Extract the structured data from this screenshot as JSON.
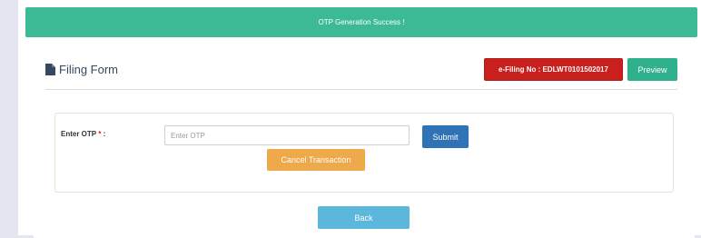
{
  "alert": {
    "message": "OTP Generation Success !"
  },
  "header": {
    "title": "Filing Form",
    "title_icon": "file-icon",
    "efiling_label": "e-Filing No : EDLWT0101502017",
    "preview_label": "Preview"
  },
  "otp_form": {
    "label": "Enter OTP",
    "required_mark": "*",
    "label_suffix": " :",
    "input_placeholder": "Enter OTP",
    "input_value": "",
    "submit_label": "Submit",
    "cancel_label": "Cancel Transaction"
  },
  "footer": {
    "back_label": "Back"
  },
  "colors": {
    "success": "#3cb995",
    "danger": "#c9201d",
    "primary": "#2f73b6",
    "warning": "#eea94a",
    "info": "#5bb8dc"
  }
}
